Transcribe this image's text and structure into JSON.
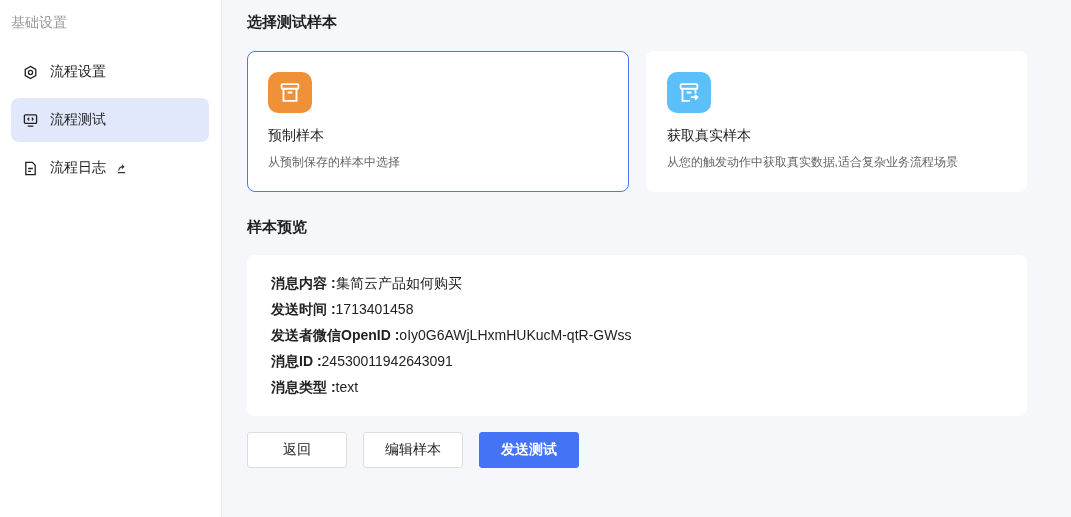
{
  "sidebar": {
    "heading": "基础设置",
    "items": [
      {
        "label": "流程设置",
        "kind": "hexagon",
        "selected": false,
        "external": false
      },
      {
        "label": "流程测试",
        "kind": "monitor",
        "selected": true,
        "external": false
      },
      {
        "label": "流程日志",
        "kind": "document",
        "selected": false,
        "external": true
      }
    ]
  },
  "sample_select": {
    "title": "选择测试样本",
    "options": [
      {
        "title": "预制样本",
        "description": "从预制保存的样本中选择",
        "kind": "box",
        "color": "#f09138",
        "selected": true
      },
      {
        "title": "获取真实样本",
        "description": "从您的触发动作中获取真实数据,适合复杂业务流程场景",
        "kind": "box-arrow",
        "color": "#5bbff9",
        "selected": false
      }
    ]
  },
  "preview": {
    "title": "样本预览",
    "fields": [
      {
        "label": "消息内容 :",
        "value": "集简云产品如何购买"
      },
      {
        "label": "发送时间 :",
        "value": "1713401458"
      },
      {
        "label": "发送者微信OpenID :",
        "value": "oIy0G6AWjLHxmHUKucM-qtR-GWss"
      },
      {
        "label": "消息ID :",
        "value": "24530011942643091"
      },
      {
        "label": "消息类型 :",
        "value": "text"
      }
    ]
  },
  "buttons": [
    {
      "label": "返回",
      "kind": "secondary"
    },
    {
      "label": "编辑样本",
      "kind": "secondary"
    },
    {
      "label": "发送测试",
      "kind": "primary"
    }
  ]
}
